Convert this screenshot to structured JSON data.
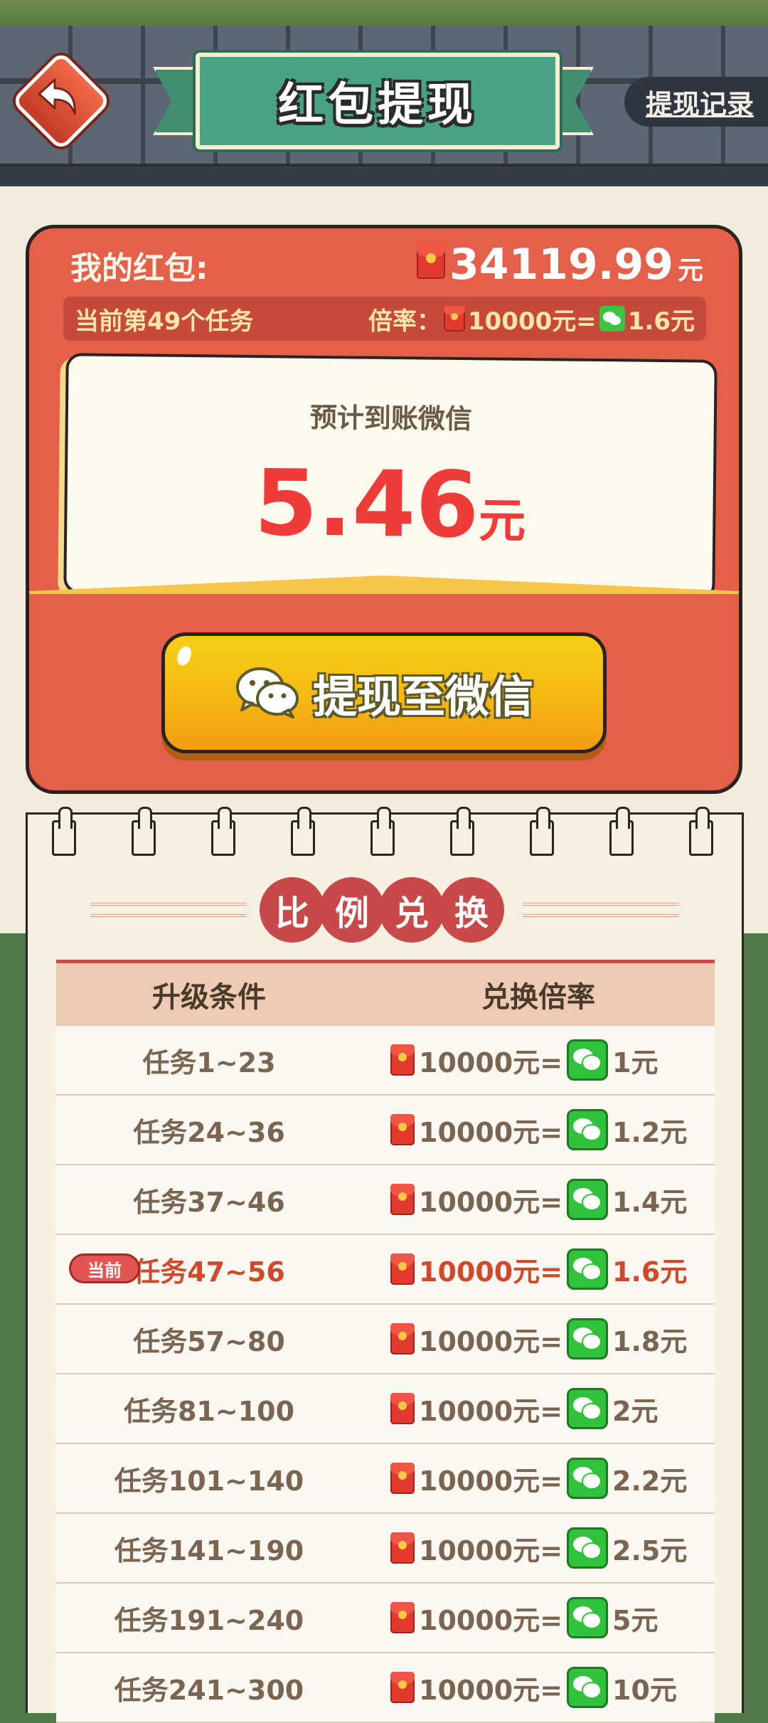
{
  "header": {
    "title": "红包提现",
    "record_label": "提现记录"
  },
  "wallet": {
    "label": "我的红包:",
    "balance": "34119.99",
    "balance_unit": "元",
    "task_text": "当前第49个任务",
    "rate_label": "倍率：",
    "rate_left": "10000元=",
    "rate_right": "1.6元"
  },
  "estimate": {
    "label": "预计到账微信",
    "amount": "5.46",
    "unit": "元"
  },
  "withdraw_button": {
    "label": "提现至微信"
  },
  "exchange": {
    "title_chars": [
      "比",
      "例",
      "兑",
      "换"
    ],
    "col_condition": "升级条件",
    "col_rate": "兑换倍率",
    "current_tag": "当前",
    "rows": [
      {
        "condition": "任务1~23",
        "left": "10000元=",
        "right": "1元"
      },
      {
        "condition": "任务24~36",
        "left": "10000元=",
        "right": "1.2元"
      },
      {
        "condition": "任务37~46",
        "left": "10000元=",
        "right": "1.4元"
      },
      {
        "condition": "任务47~56",
        "left": "10000元=",
        "right": "1.6元"
      },
      {
        "condition": "任务57~80",
        "left": "10000元=",
        "right": "1.8元"
      },
      {
        "condition": "任务81~100",
        "left": "10000元=",
        "right": "2元"
      },
      {
        "condition": "任务101~140",
        "left": "10000元=",
        "right": "2.2元"
      },
      {
        "condition": "任务141~190",
        "left": "10000元=",
        "right": "2.5元"
      },
      {
        "condition": "任务191~240",
        "left": "10000元=",
        "right": "5元"
      },
      {
        "condition": "任务241~300",
        "left": "10000元=",
        "right": "10元"
      }
    ]
  },
  "colors": {
    "packet_red": "#e4604a",
    "amount_red": "#ef3b39",
    "button_yellow": "#f5b814",
    "wechat_green": "#2fc23a",
    "banner_green": "#49a383"
  }
}
